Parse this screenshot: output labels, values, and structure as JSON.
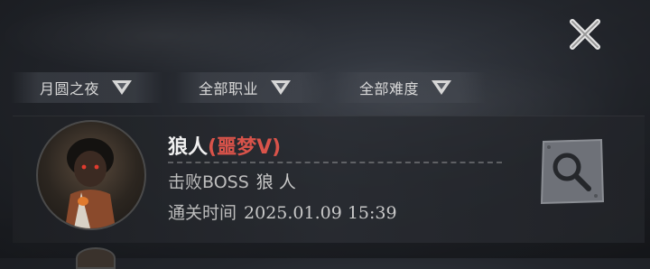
{
  "filters": [
    {
      "label": "月圆之夜"
    },
    {
      "label": "全部职业"
    },
    {
      "label": "全部难度"
    }
  ],
  "record": {
    "boss_name": "狼人",
    "difficulty": "(噩梦V)",
    "defeat_label": "击败BOSS",
    "defeat_value": "狼 人",
    "time_label": "通关时间",
    "time_value": "2025.01.09 15:39"
  },
  "icons": {
    "close": "close-icon",
    "filter_arrow": "dropdown-arrow-icon",
    "replay": "magnifier-icon"
  },
  "colors": {
    "difficulty": "#d9534a",
    "background": "#23262c"
  }
}
